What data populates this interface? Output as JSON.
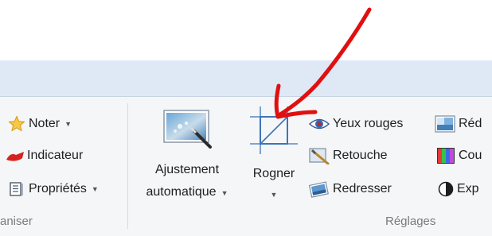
{
  "organize_group": {
    "label": "aniser",
    "items": [
      {
        "label": "Noter",
        "icon": "star-icon",
        "has_dropdown": true
      },
      {
        "label": "Indicateur",
        "icon": "flag-icon",
        "has_dropdown": false
      },
      {
        "label": "Propriétés",
        "icon": "properties-icon",
        "has_dropdown": true
      }
    ]
  },
  "adjust_group": {
    "label": "Réglages",
    "auto_adjust": {
      "line1": "Ajustement",
      "line2": "automatique",
      "icon": "auto-adjust-icon"
    },
    "crop": {
      "label": "Rogner",
      "icon": "crop-icon"
    },
    "column1": [
      {
        "label": "Yeux rouges",
        "icon": "red-eye-icon"
      },
      {
        "label": "Retouche",
        "icon": "retouch-icon"
      },
      {
        "label": "Redresser",
        "icon": "straighten-icon"
      }
    ],
    "column2": [
      {
        "label": "Réd",
        "icon": "resize-icon"
      },
      {
        "label": "Cou",
        "icon": "color-icon"
      },
      {
        "label": "Exp",
        "icon": "exposure-icon"
      }
    ]
  },
  "annotation": {
    "color": "#e01010",
    "icon": "red-arrow-annotation"
  }
}
